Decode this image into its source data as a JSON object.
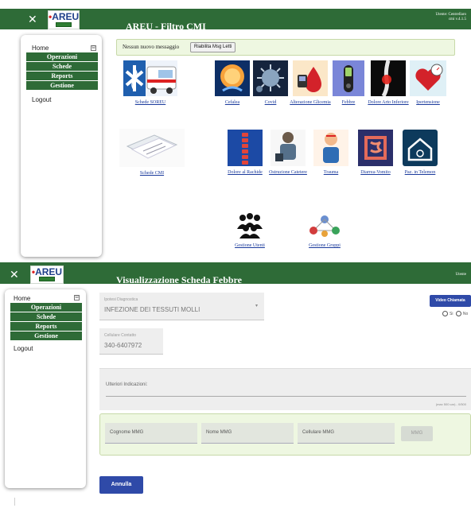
{
  "brand": {
    "logo_text": "AREU"
  },
  "filtro": {
    "title": "AREU - Filtro CMI",
    "user_line1": "Utente: Centrellaro",
    "user_line2": "cmi v.4.1.5",
    "sidebar": {
      "home": "Home",
      "menu": [
        "Operazioni",
        "Schede",
        "Reports",
        "Gestione"
      ],
      "logout": "Logout"
    },
    "message": "Nessun nuovo messaggio",
    "message_button": "Riabilita Msg Letti",
    "tiles": [
      {
        "label": "Schede SOREU",
        "icon": "ambulance-image"
      },
      {
        "label": "Cefalea",
        "icon": "brain-head-image"
      },
      {
        "label": "Covid",
        "icon": "virus-image"
      },
      {
        "label": "Alterazione Glicemia",
        "icon": "blood-drop-image"
      },
      {
        "label": "Febbre",
        "icon": "thermometer-image"
      },
      {
        "label": "Dolore Arto Inferiore",
        "icon": "leg-xray-image"
      },
      {
        "label": "Ipertensione",
        "icon": "heart-pressure-image"
      },
      {
        "label": "Schede CMI",
        "icon": "documents-image"
      },
      {
        "label": "Dolore al Rachide",
        "icon": "spine-image"
      },
      {
        "label": "Ostruzione Catetere",
        "icon": "catheter-image"
      },
      {
        "label": "Trauma",
        "icon": "trauma-image"
      },
      {
        "label": "Diarrea-Vomito",
        "icon": "intestine-image"
      },
      {
        "label": "Paz. in Telemon",
        "icon": "home-monitor-image"
      },
      {
        "label": "Gestione Utenti",
        "icon": "users-group-image"
      },
      {
        "label": "Gestione Gruppi",
        "icon": "groups-image"
      }
    ]
  },
  "febbre": {
    "title": "Visualizzazione Scheda Febbre",
    "user": "Utente",
    "sidebar": {
      "home": "Home",
      "menu": [
        "Operazioni",
        "Schede",
        "Reports",
        "Gestione"
      ],
      "logout": "Logout"
    },
    "ipotesi_label": "Ipotesi Diagnostica",
    "ipotesi_value": "INFEZIONE DEI TESSUTI MOLLI",
    "cellulare_label": "Cellulare Contatto",
    "cellulare_value": "340-6407972",
    "video_button": "Video Chiamata",
    "radio_si": "Si",
    "radio_no": "No",
    "notes_label": "Ulteriori Indicazioni:",
    "notes_counter": "(max 500 car) - 0/500",
    "cognome_placeholder": "Cognome MMG",
    "nome_placeholder": "Nome MMG",
    "cellulare_mmg_placeholder": "Cellulare MMG",
    "mmg_button": "MMG",
    "annulla_button": "Annulla"
  }
}
